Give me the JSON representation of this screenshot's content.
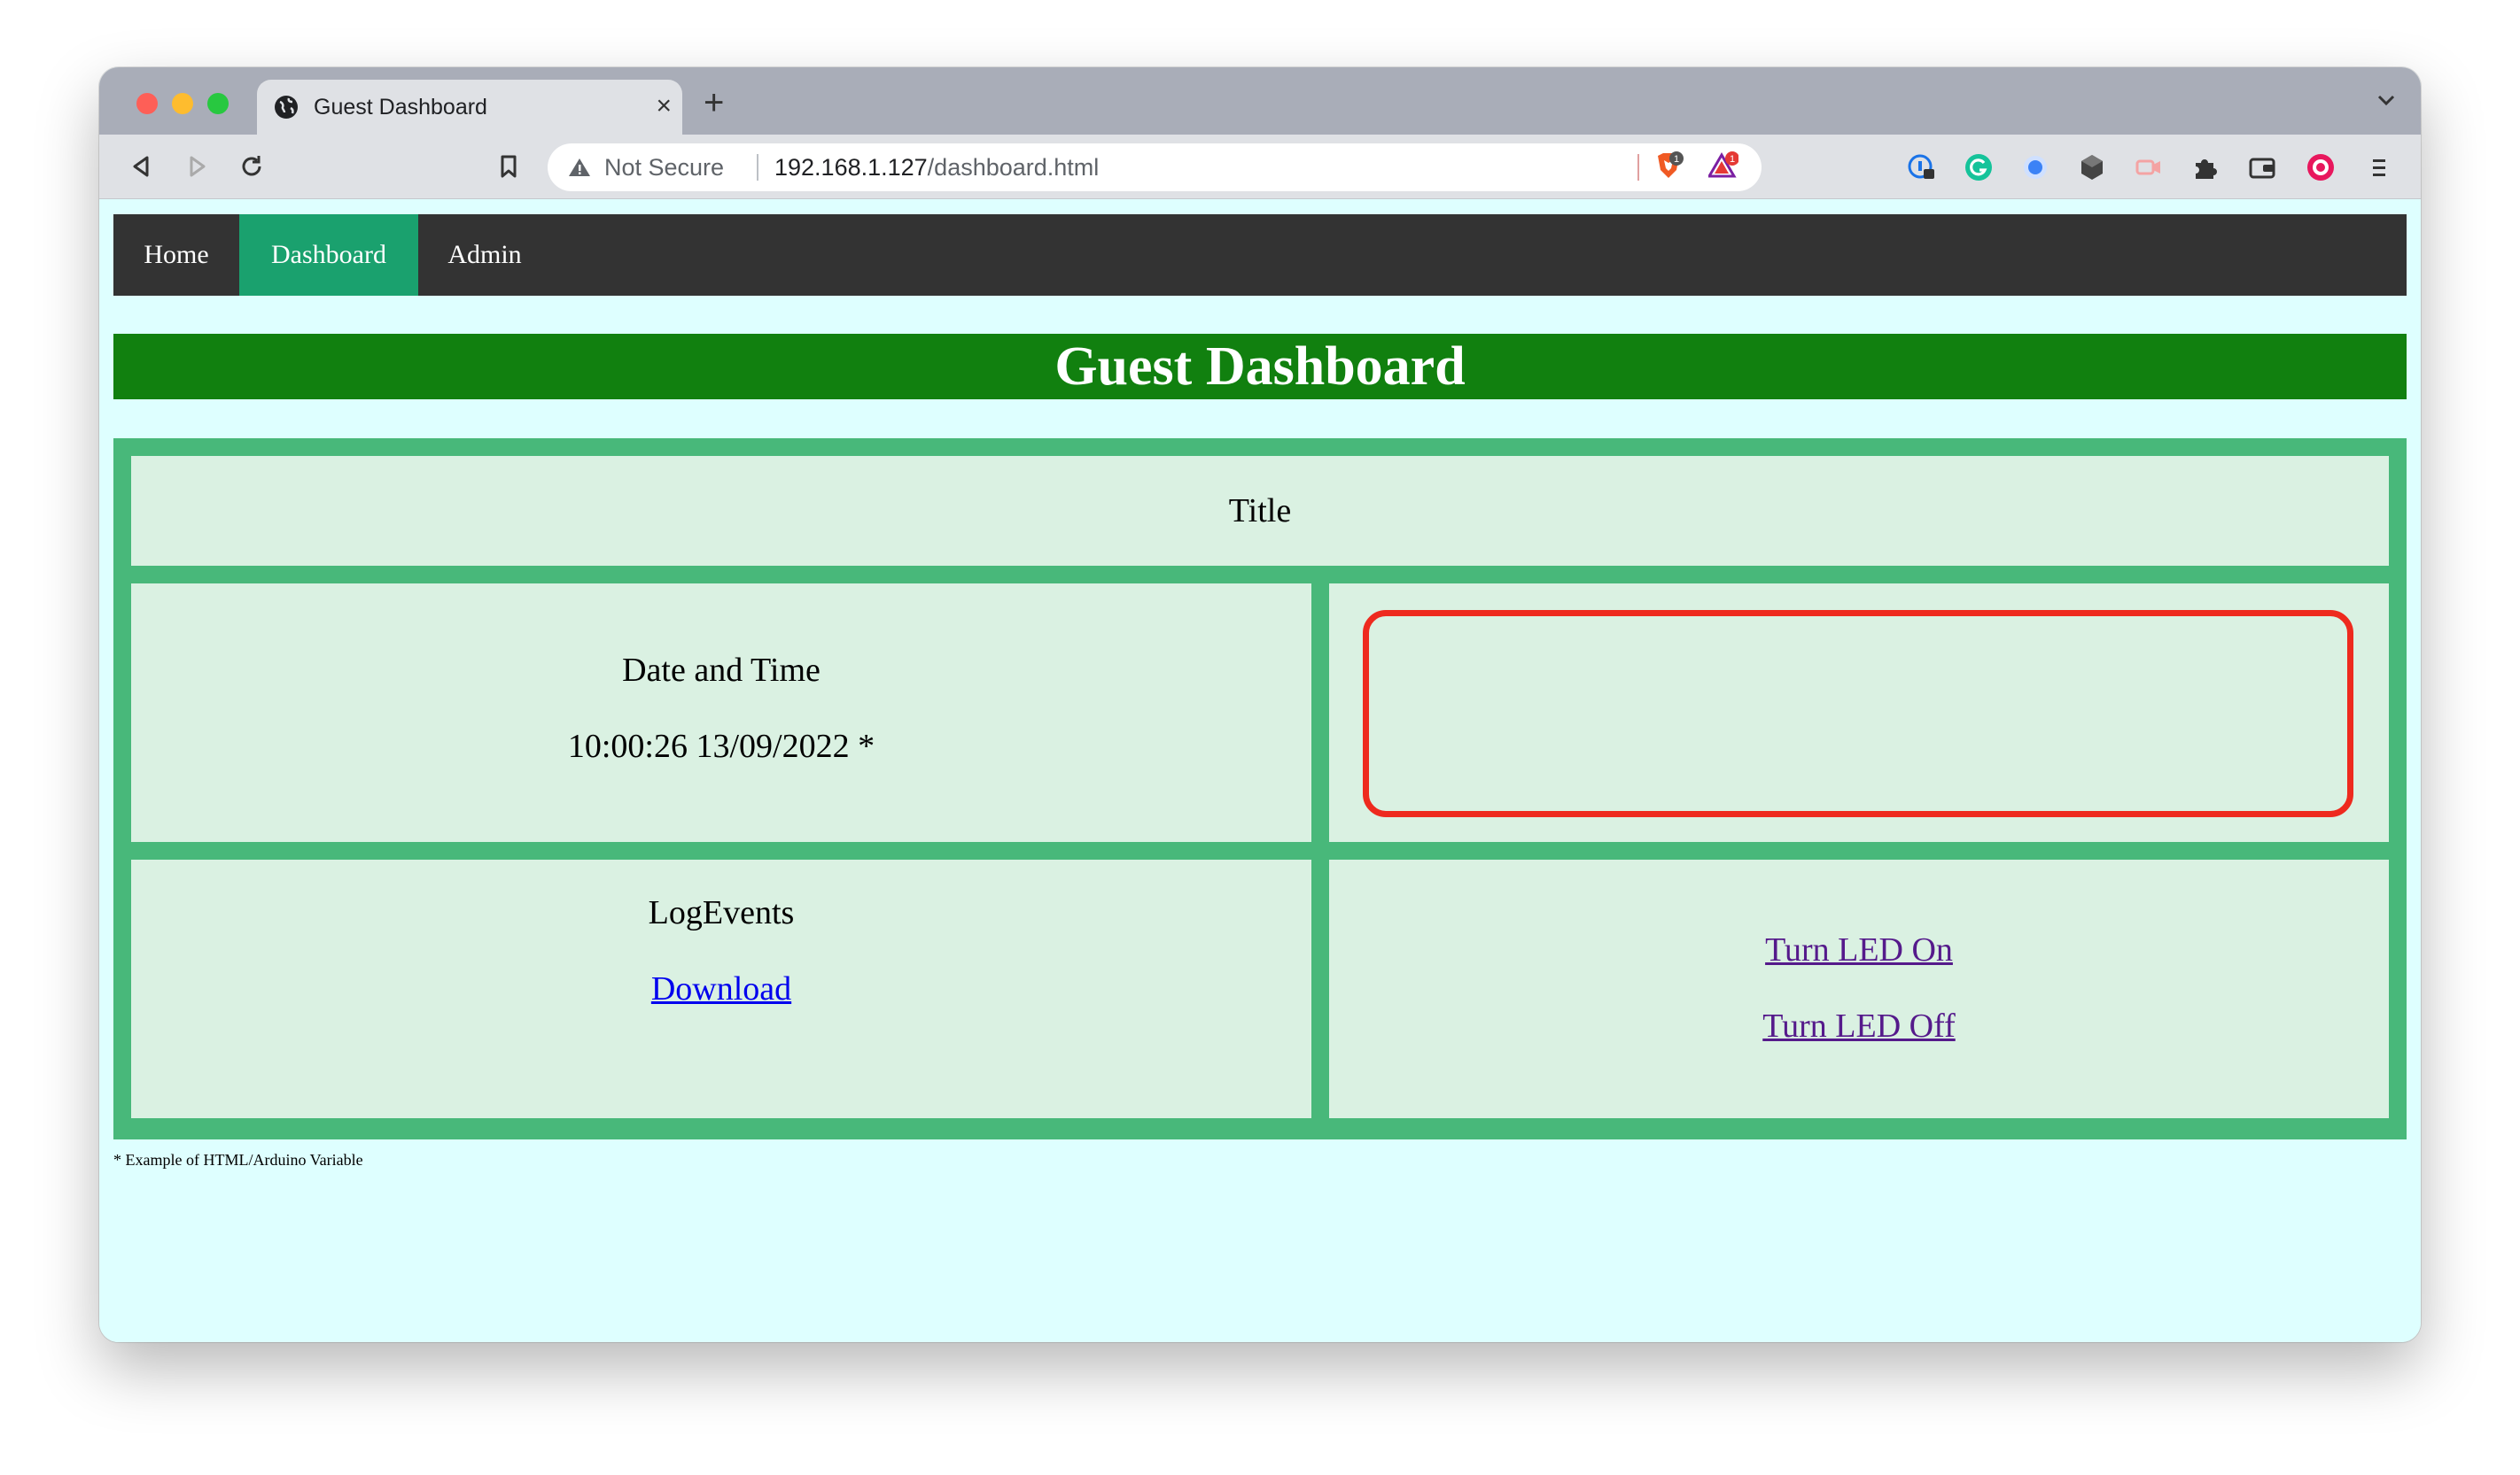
{
  "browser": {
    "tab_title": "Guest Dashboard",
    "tab_close": "×",
    "new_tab": "+",
    "security_label": "Not Secure",
    "url_host": "192.168.1.127",
    "url_path": "/dashboard.html",
    "brave_shield_count": "1",
    "rewards_count": "1"
  },
  "nav": {
    "home": "Home",
    "dashboard": "Dashboard",
    "admin": "Admin",
    "active": "Dashboard",
    "active_color": "#1aa16e"
  },
  "page": {
    "heading": "Guest Dashboard",
    "title_cell": "Title",
    "datetime_label": "Date and Time",
    "datetime_value": "10:00:26 13/09/2022 *",
    "log_label": "LogEvents",
    "download_link": "Download",
    "led_on": "Turn LED On",
    "led_off": "Turn LED Off",
    "footnote": "* Example of HTML/Arduino Variable"
  },
  "colors": {
    "banner": "#11800f",
    "grid_border": "#48b87a",
    "cell_bg": "#daf1e2",
    "page_bg": "#deffff",
    "highlight": "#ee2a1e"
  }
}
